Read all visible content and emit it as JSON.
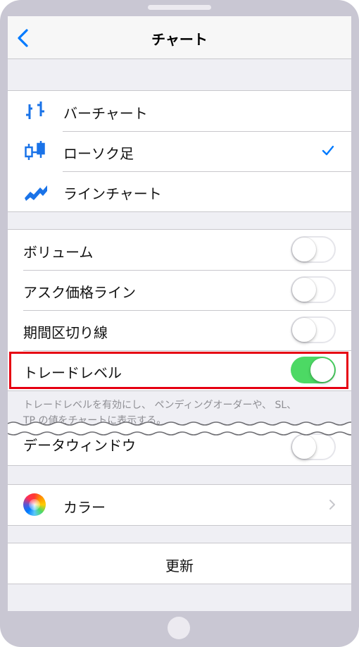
{
  "nav": {
    "title": "チャート",
    "back_icon": "chevron-left-icon"
  },
  "chart_types": {
    "items": [
      {
        "label": "バーチャート",
        "icon": "bar-chart-icon",
        "selected": false
      },
      {
        "label": "ローソク足",
        "icon": "candlestick-icon",
        "selected": true
      },
      {
        "label": "ラインチャート",
        "icon": "line-chart-icon",
        "selected": false
      }
    ]
  },
  "toggles": {
    "items": [
      {
        "label": "ボリューム",
        "on": false
      },
      {
        "label": "アスク価格ライン",
        "on": false
      },
      {
        "label": "期間区切り線",
        "on": false
      },
      {
        "label": "トレードレベル",
        "on": true
      }
    ],
    "footer_line1": "トレードレベルを有効にし、 ペンディングオーダーや、 SL、",
    "footer_line2": "TP の値をチャートに表示する。"
  },
  "data_window": {
    "label": "データウィンドウ",
    "on": false
  },
  "color": {
    "label": "カラー",
    "icon": "color-wheel-icon"
  },
  "update": {
    "label": "更新"
  },
  "colors": {
    "accent": "#007aff",
    "switch_on": "#4cd964",
    "highlight": "#e60012",
    "background": "#efeff4"
  }
}
